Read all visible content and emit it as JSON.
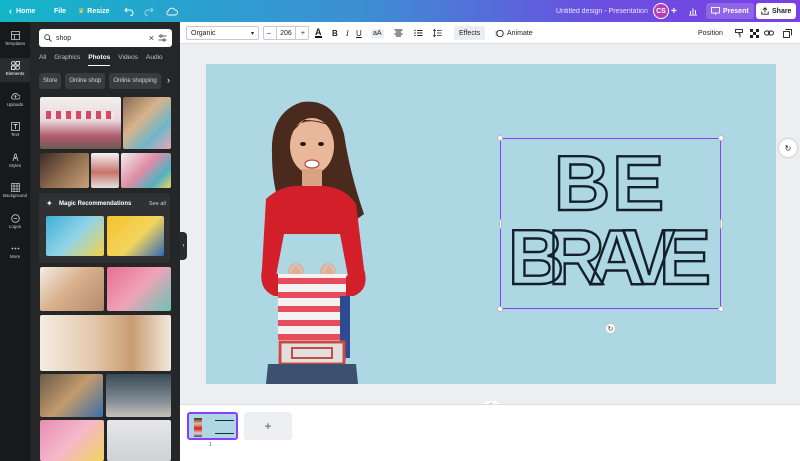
{
  "topbar": {
    "home": "Home",
    "file": "File",
    "resize": "Resize",
    "doc_title": "Untitled design - Presentation",
    "avatar_initials": "CS",
    "present": "Present",
    "share": "Share"
  },
  "rail": {
    "items": [
      {
        "label": "Templates",
        "icon": "templates-icon"
      },
      {
        "label": "Elements",
        "icon": "elements-icon"
      },
      {
        "label": "Uploads",
        "icon": "upload-icon"
      },
      {
        "label": "Text",
        "icon": "text-icon"
      },
      {
        "label": "Styles",
        "icon": "styles-icon"
      },
      {
        "label": "Background",
        "icon": "background-icon"
      },
      {
        "label": "Logos",
        "icon": "logos-icon"
      },
      {
        "label": "More",
        "icon": "more-icon"
      }
    ]
  },
  "panel": {
    "search_value": "shop",
    "tabs": [
      "All",
      "Graphics",
      "Photos",
      "Videos",
      "Audio"
    ],
    "active_tab": "Photos",
    "chips": [
      "Store",
      "Online shop",
      "Online shopping"
    ],
    "magic_title": "Magic Recommendations",
    "magic_see_all": "See all"
  },
  "toolbar": {
    "font": "Organic",
    "font_size": "206",
    "effects": "Effects",
    "animate": "Animate",
    "position": "Position"
  },
  "design": {
    "line1": "BE",
    "line2": "BRAVE",
    "background": "#add8e3"
  },
  "pages": {
    "page_number": "1",
    "add": "+"
  },
  "colors": {
    "accent": "#8b3dff",
    "canvas_bg": "#add8e3",
    "rail_bg": "#18191b",
    "panel_bg": "#252627"
  }
}
